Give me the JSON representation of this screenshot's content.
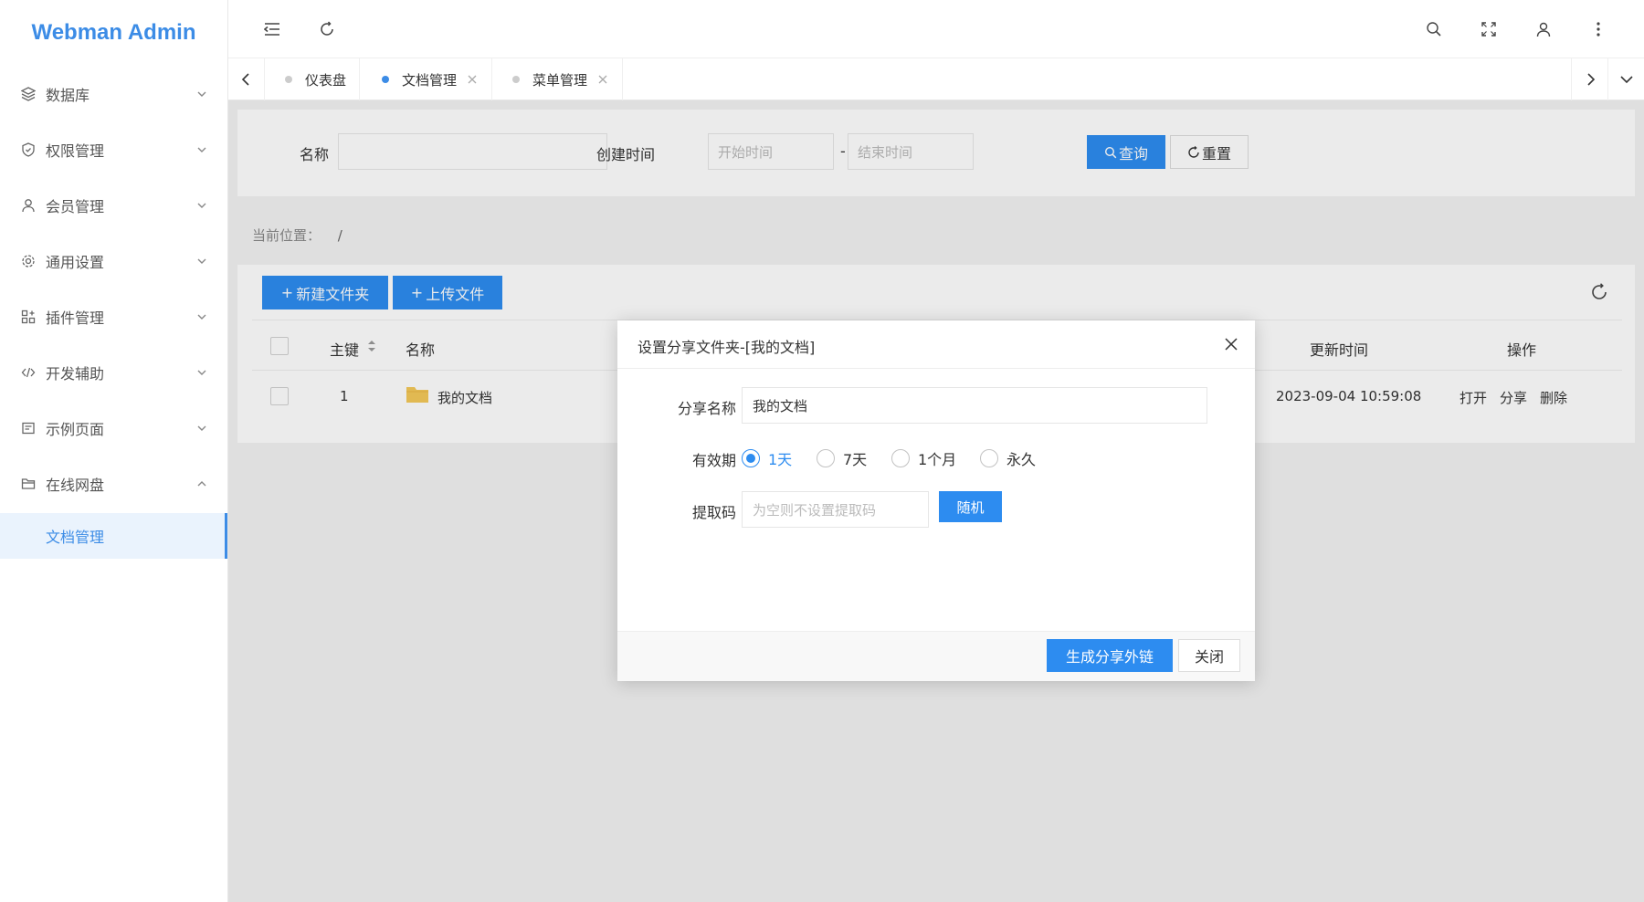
{
  "app": {
    "title": "Webman Admin"
  },
  "sidebar": {
    "items": [
      {
        "label": "数据库",
        "icon": "database-icon",
        "expanded": false
      },
      {
        "label": "权限管理",
        "icon": "shield-icon",
        "expanded": false
      },
      {
        "label": "会员管理",
        "icon": "user-icon",
        "expanded": false
      },
      {
        "label": "通用设置",
        "icon": "gear-icon",
        "expanded": false
      },
      {
        "label": "插件管理",
        "icon": "grid-plus-icon",
        "expanded": false
      },
      {
        "label": "开发辅助",
        "icon": "code-icon",
        "expanded": false
      },
      {
        "label": "示例页面",
        "icon": "page-icon",
        "expanded": false
      },
      {
        "label": "在线网盘",
        "icon": "folder-icon",
        "expanded": true
      }
    ],
    "submenu": {
      "label": "文档管理"
    }
  },
  "header": {
    "icons": [
      "menu-fold-icon",
      "refresh-icon",
      "search-icon",
      "fullscreen-icon",
      "user-icon",
      "more-vertical-icon"
    ]
  },
  "tabs": [
    {
      "label": "仪表盘",
      "active": false,
      "closable": false
    },
    {
      "label": "文档管理",
      "active": true,
      "closable": true
    },
    {
      "label": "菜单管理",
      "active": false,
      "closable": true
    }
  ],
  "search": {
    "name_label": "名称",
    "name_value": "",
    "created_label": "创建时间",
    "start_placeholder": "开始时间",
    "range_sep": "-",
    "end_placeholder": "结束时间",
    "query_button": "查询",
    "reset_button": "重置"
  },
  "breadcrumb": {
    "label": "当前位置：",
    "path": "/"
  },
  "toolbar": {
    "new_folder": "新建文件夹",
    "upload_file": "上传文件"
  },
  "table": {
    "headers": {
      "id": "主键",
      "name": "名称",
      "updated": "更新时间",
      "actions": "操作"
    },
    "rows": [
      {
        "id": "1",
        "name": "我的文档",
        "updated": "2023-09-04 10:59:08",
        "actions": [
          "打开",
          "分享",
          "删除"
        ]
      }
    ]
  },
  "modal": {
    "title": "设置分享文件夹-[我的文档]",
    "share_name_label": "分享名称",
    "share_name_value": "我的文档",
    "validity_label": "有效期",
    "validity_options": [
      "1天",
      "7天",
      "1个月",
      "永久"
    ],
    "validity_selected": "1天",
    "code_label": "提取码",
    "code_placeholder": "为空则不设置提取码",
    "random_button": "随机",
    "generate_button": "生成分享外链",
    "close_button": "关闭"
  },
  "colors": {
    "primary": "#2d8cf0",
    "logo": "#3c8ce6"
  }
}
